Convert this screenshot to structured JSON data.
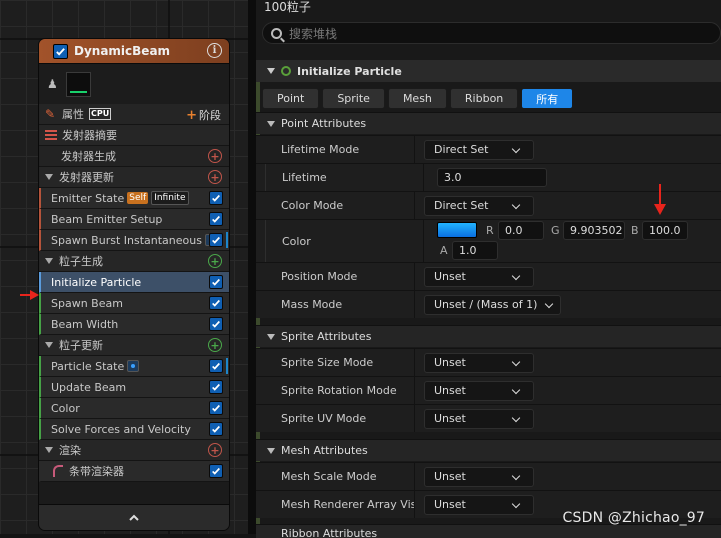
{
  "graph": {
    "node": {
      "title": "DynamicBeam",
      "properties_label": "属性",
      "sim_target": "CPU",
      "add_stage_label": "阶段",
      "rows": [
        {
          "kind": "section-plain",
          "label": "发射器摘要"
        },
        {
          "kind": "sub",
          "label": "发射器生成"
        },
        {
          "kind": "section",
          "label": "发射器更新"
        },
        {
          "kind": "item",
          "label": "Emitter State",
          "badges": [
            "Self",
            "Infinite"
          ]
        },
        {
          "kind": "item",
          "label": "Beam Emitter Setup"
        },
        {
          "kind": "item",
          "label": "Spawn Burst Instantaneous",
          "dot": true
        },
        {
          "kind": "section",
          "label": "粒子生成"
        },
        {
          "kind": "item",
          "label": "Initialize Particle",
          "selected": true
        },
        {
          "kind": "item",
          "label": "Spawn Beam"
        },
        {
          "kind": "item",
          "label": "Beam Width"
        },
        {
          "kind": "section",
          "label": "粒子更新"
        },
        {
          "kind": "item",
          "label": "Particle State",
          "dot": true
        },
        {
          "kind": "item",
          "label": "Update Beam"
        },
        {
          "kind": "item",
          "label": "Color"
        },
        {
          "kind": "item",
          "label": "Solve Forces and Velocity"
        },
        {
          "kind": "section",
          "label": "渲染"
        },
        {
          "kind": "renderer",
          "label": "条带渲染器"
        }
      ],
      "footer_icon": "chevron-up-icon"
    }
  },
  "details": {
    "title": "100粒子",
    "search_placeholder": "搜索堆栈",
    "module_title": "Initialize Particle",
    "filters": [
      "Point",
      "Sprite",
      "Mesh",
      "Ribbon",
      "所有"
    ],
    "active_filter": "所有",
    "point_attributes": {
      "header": "Point Attributes",
      "lifetime_mode_label": "Lifetime Mode",
      "lifetime_mode_value": "Direct Set",
      "lifetime_label": "Lifetime",
      "lifetime_value": "3.0",
      "color_mode_label": "Color Mode",
      "color_mode_value": "Direct Set",
      "color_label": "Color",
      "color": {
        "R": "0.0",
        "G": "9.903502",
        "B": "100.0",
        "A": "1.0"
      },
      "position_mode_label": "Position Mode",
      "position_mode_value": "Unset",
      "mass_mode_label": "Mass Mode",
      "mass_mode_value": "Unset / (Mass of 1)"
    },
    "sprite_attributes": {
      "header": "Sprite Attributes",
      "size_mode_label": "Sprite Size Mode",
      "size_mode_value": "Unset",
      "rotation_mode_label": "Sprite Rotation Mode",
      "rotation_mode_value": "Unset",
      "uv_mode_label": "Sprite UV Mode",
      "uv_mode_value": "Unset"
    },
    "mesh_attributes": {
      "header": "Mesh Attributes",
      "scale_mode_label": "Mesh Scale Mode",
      "scale_mode_value": "Unset",
      "renderer_array_label": "Mesh Renderer Array Visi",
      "renderer_array_value": "Unset"
    },
    "ribbon_attributes_header": "Ribbon Attributes"
  },
  "watermark": "CSDN @Zhichao_97",
  "colors": {
    "accent": "#1e86e8",
    "node_header": "#a2532a",
    "selected_row": "#3d5068",
    "annotation_arrow": "#e8241c",
    "color_swatch": "#22b4ff"
  }
}
